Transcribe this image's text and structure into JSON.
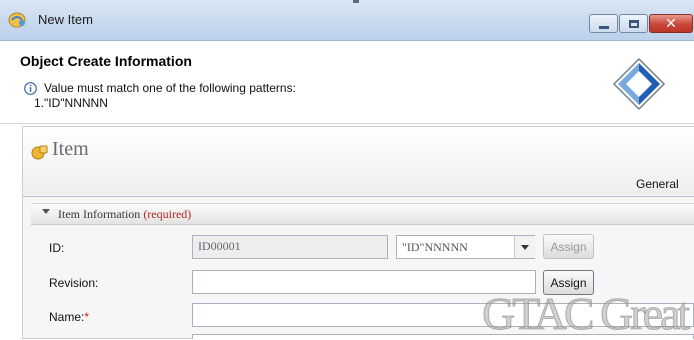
{
  "window": {
    "title": "New Item",
    "controls": {
      "minimize": "minimize",
      "maximize": "maximize",
      "close": "close"
    }
  },
  "header": {
    "title": "Object Create Information",
    "message": "Value must match one of the following patterns:",
    "pattern_line": "1.\"ID\"NNNNN",
    "info_icon": "info-icon",
    "wizard_icon": "diamond-wizard-icon"
  },
  "item_panel": {
    "heading": "Item",
    "tab": "General",
    "section": {
      "label": "Item Information",
      "required": "(required)"
    }
  },
  "form": {
    "id": {
      "label": "ID:",
      "value": "ID00001",
      "pattern": "\"ID\"NNNNN",
      "assign": "Assign"
    },
    "revision": {
      "label": "Revision:",
      "value": "",
      "assign": "Assign"
    },
    "name": {
      "label": "Name:",
      "required_marker": "*",
      "value": ""
    }
  },
  "watermark": "GTAC Great",
  "colors": {
    "required": "#b0281f",
    "titlebar": "#c7d9ee",
    "close": "#c8473a"
  }
}
